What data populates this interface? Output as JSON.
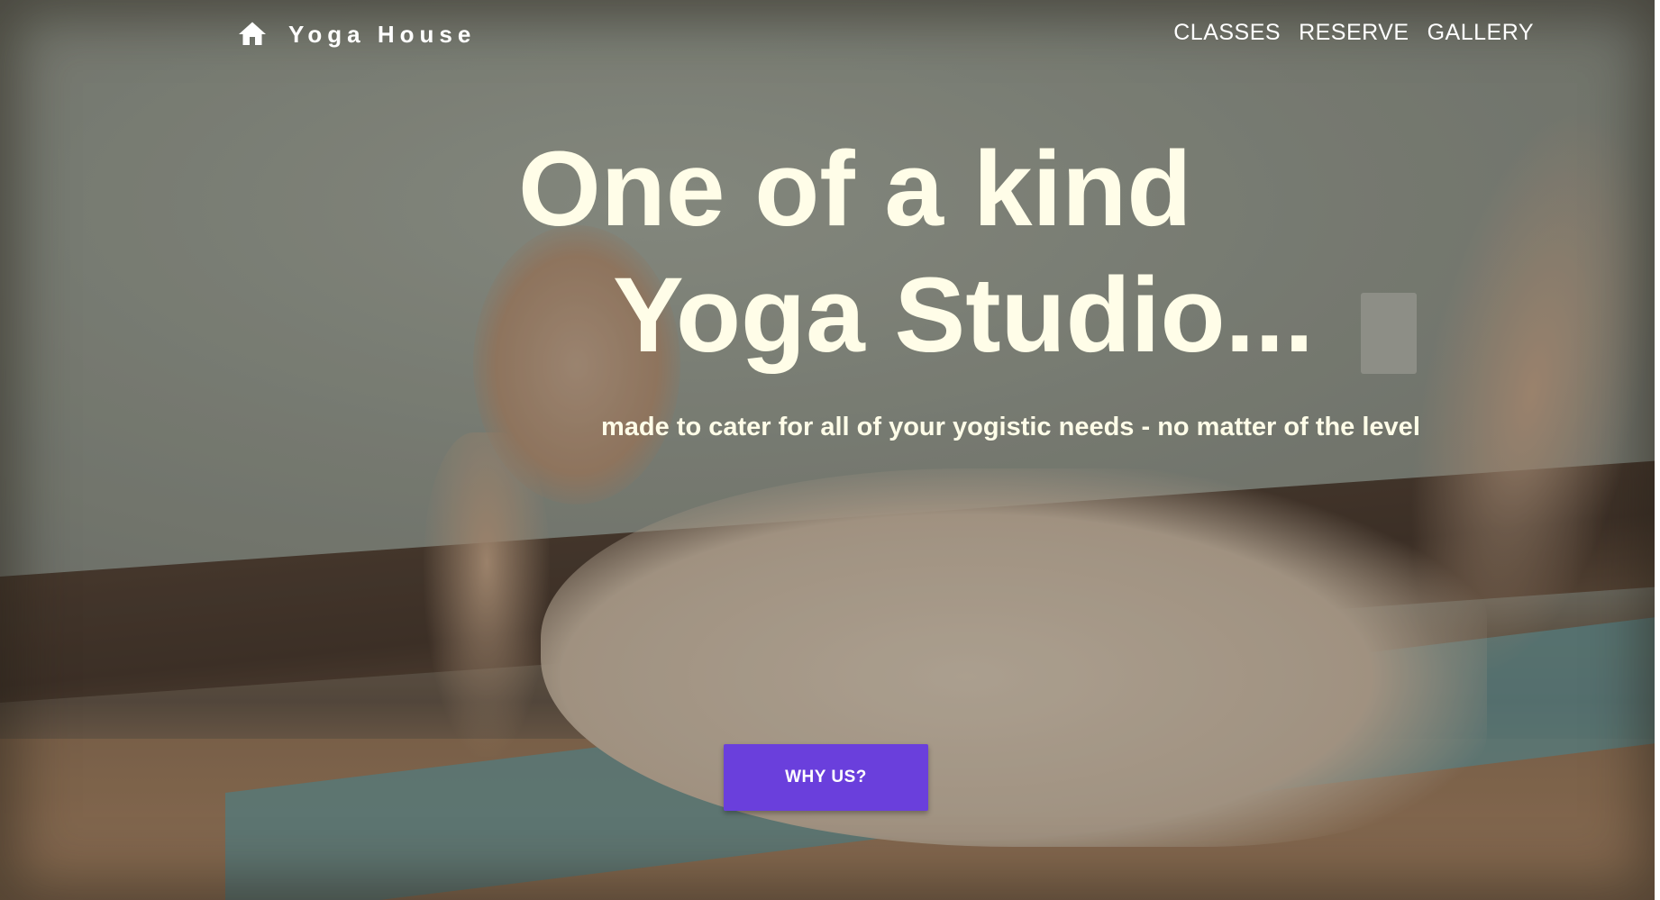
{
  "brand": {
    "icon": "home-icon",
    "name": "Yoga House"
  },
  "nav": {
    "links": [
      {
        "label": "CLASSES"
      },
      {
        "label": "RESERVE"
      },
      {
        "label": "GALLERY"
      }
    ]
  },
  "hero": {
    "headline_line1": "One of a kind",
    "headline_line2": "Yoga Studio...",
    "subtitle": "made to cater for all of your yogistic needs - no matter of the level",
    "cta_label": "WHY US?"
  },
  "colors": {
    "accent": "#6a3fdc",
    "headline_text": "#fffde8",
    "nav_text": "#ffffff"
  }
}
